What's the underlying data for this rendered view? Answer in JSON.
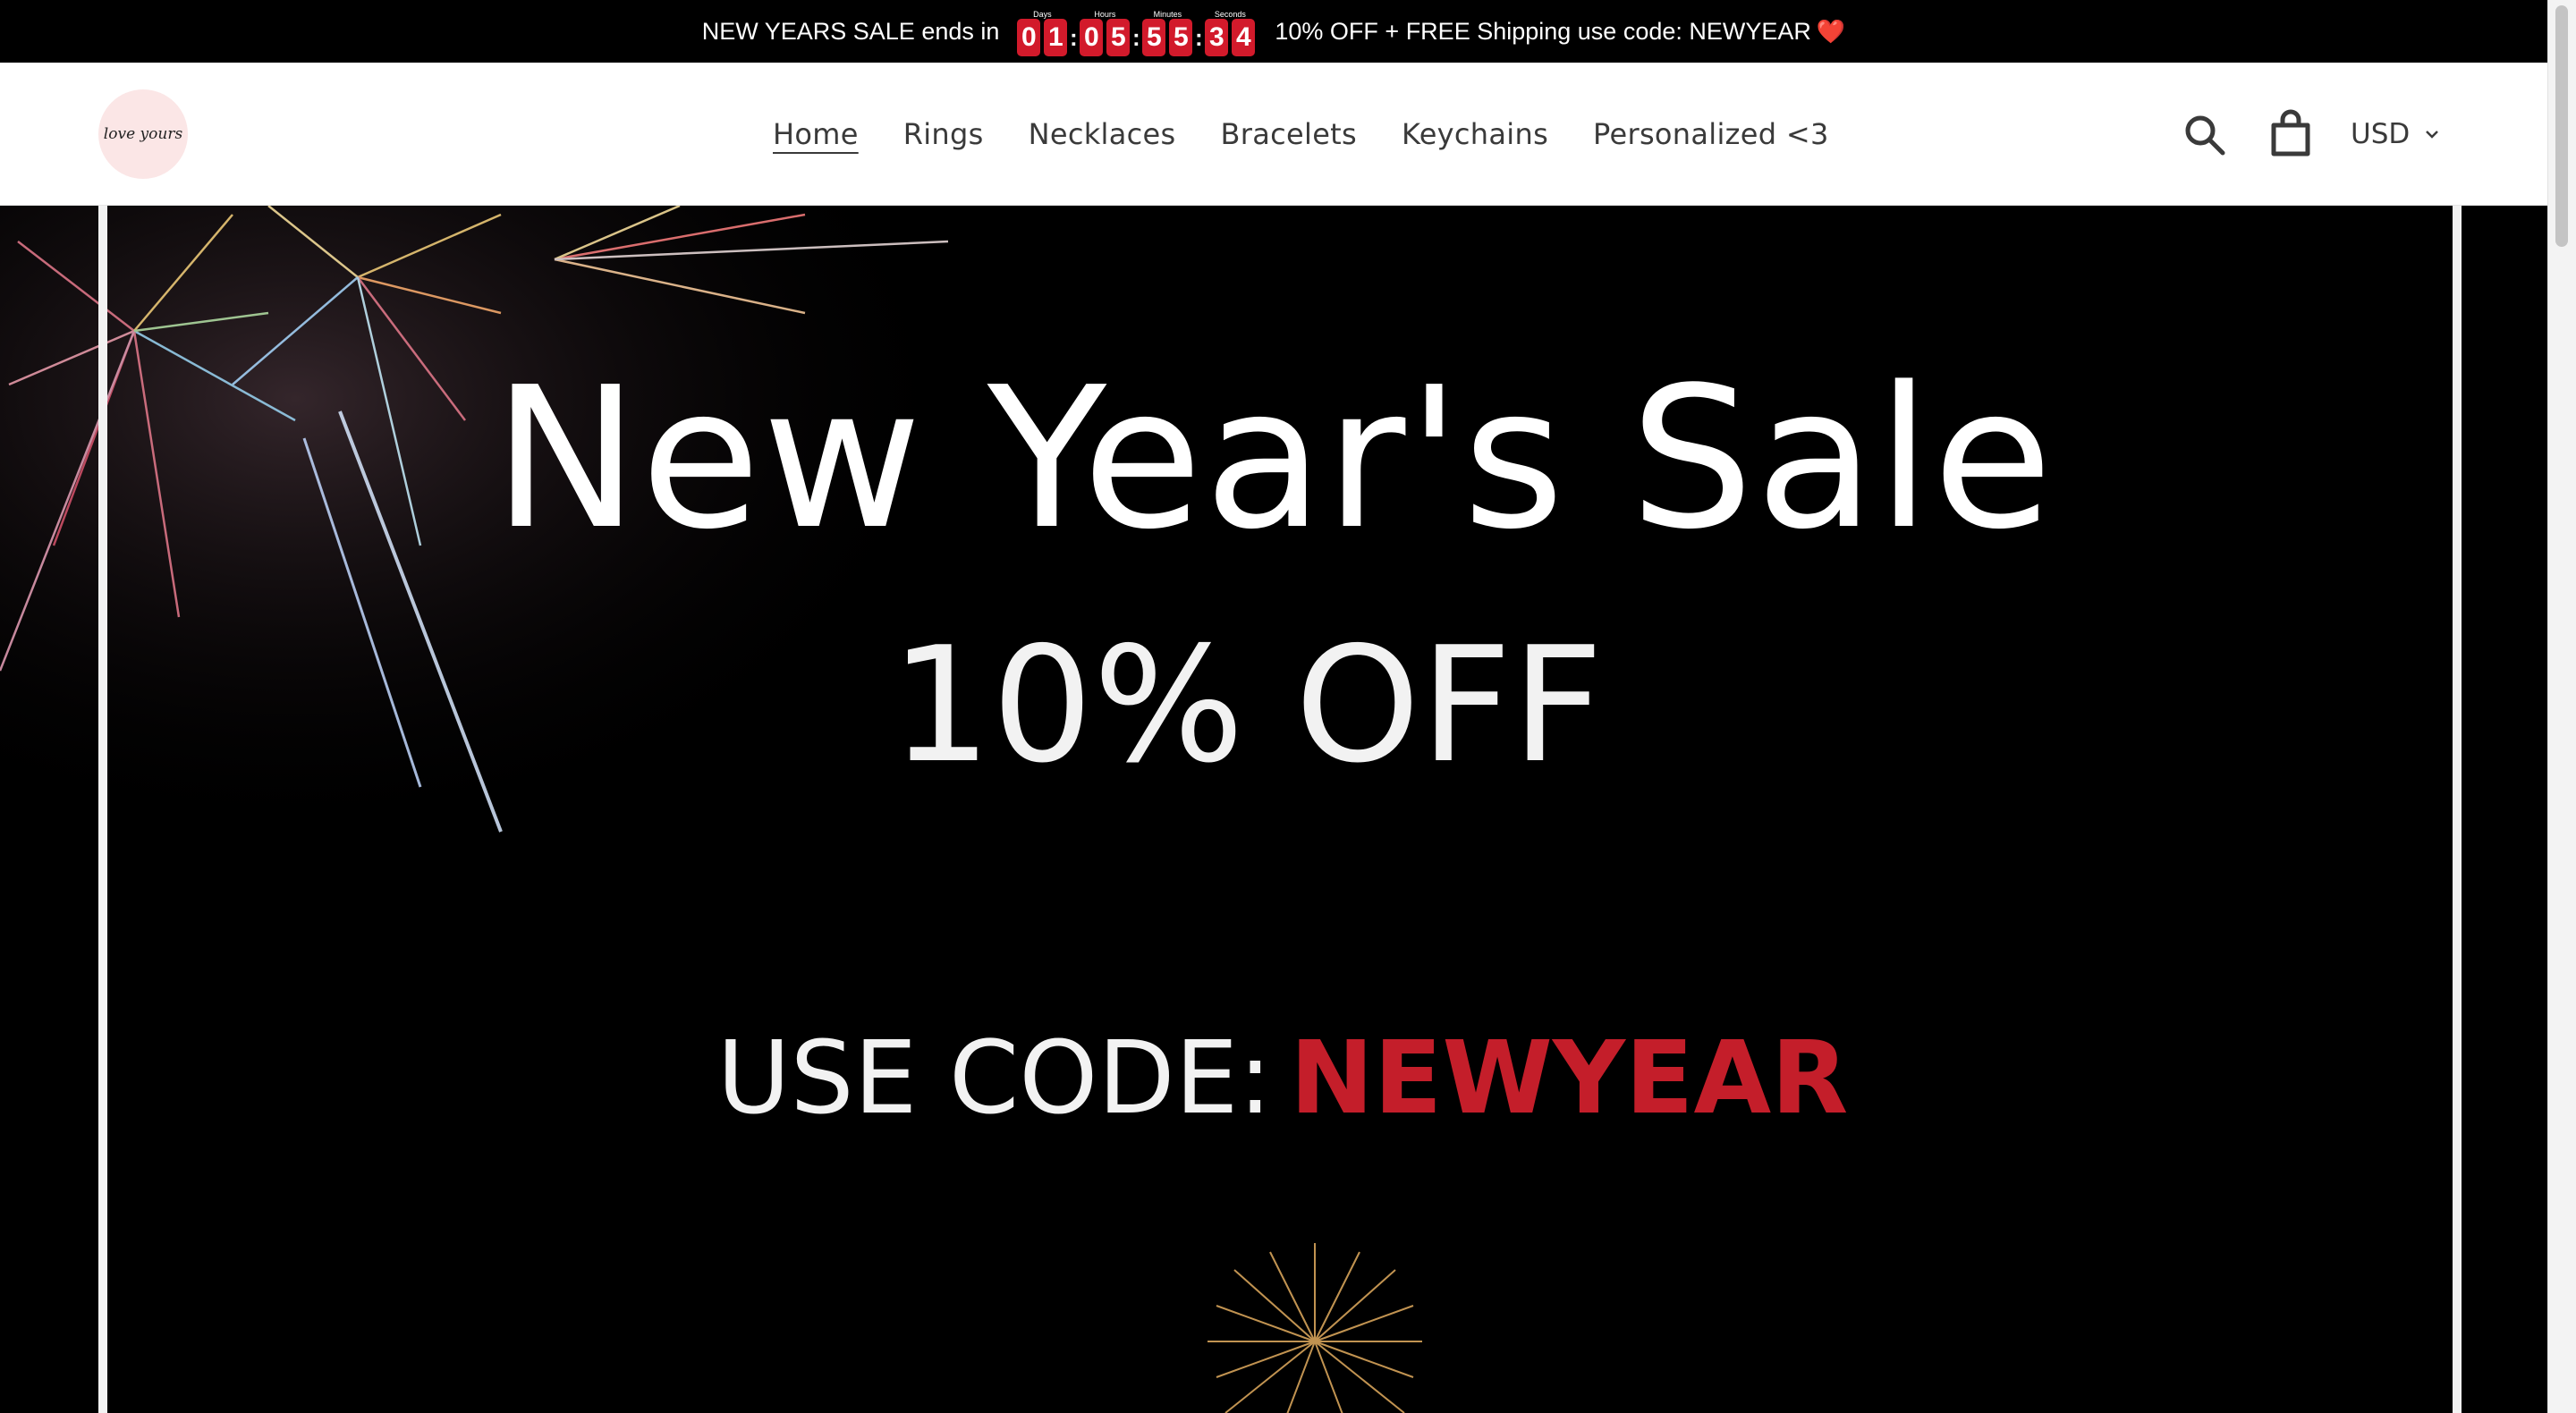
{
  "announcement": {
    "lead": "NEW YEARS SALE ends in",
    "countdown": {
      "days": {
        "caption": "Days",
        "digits": [
          "0",
          "1"
        ]
      },
      "hours": {
        "caption": "Hours",
        "digits": [
          "0",
          "5"
        ]
      },
      "minutes": {
        "caption": "Minutes",
        "digits": [
          "5",
          "5"
        ]
      },
      "seconds": {
        "caption": "Seconds",
        "digits": [
          "3",
          "4"
        ]
      },
      "separator": ":"
    },
    "trail": "10% OFF + FREE Shipping use code: NEWYEAR",
    "heart": "❤️"
  },
  "header": {
    "logo_text": "love yours",
    "nav": [
      {
        "label": "Home",
        "active": true
      },
      {
        "label": "Rings"
      },
      {
        "label": "Necklaces"
      },
      {
        "label": "Bracelets"
      },
      {
        "label": "Keychains"
      },
      {
        "label": "Personalized <3"
      }
    ],
    "currency": "USD"
  },
  "hero": {
    "title": "New Year's Sale",
    "subtitle": "10% OFF",
    "code_prefix": "USE CODE:",
    "code": "NEWYEAR"
  },
  "colors": {
    "countdown_digit_bg": "#d21a2b",
    "code_red": "#c41e2a",
    "logo_bg": "#fbe6e6"
  },
  "icons": [
    "search-icon",
    "cart-icon",
    "chevron-down-icon",
    "heart-icon"
  ]
}
